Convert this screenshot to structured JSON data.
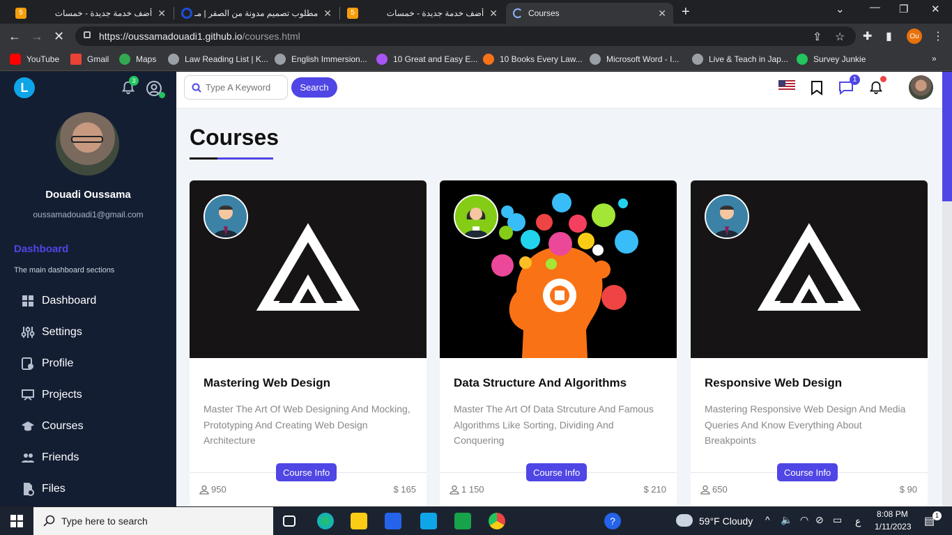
{
  "browser": {
    "tabs": [
      {
        "title": "أضف خدمة جديدة - خمسات",
        "favicon_color": "#f59e0b",
        "favicon_text": "5",
        "active": false
      },
      {
        "title": "مطلوب تصميم مدونة من الصفر | مـ",
        "favicon_color": "#1d4ed8",
        "favicon_text": "",
        "active": false
      },
      {
        "title": "أضف خدمة جديدة - خمسات",
        "favicon_color": "#f59e0b",
        "favicon_text": "5",
        "active": false
      },
      {
        "title": "Courses",
        "favicon_color": "#8ab4f8",
        "favicon_text": "",
        "active": true
      }
    ],
    "url_host": "https://oussamadouadi1.github.io",
    "url_path": "/courses.html",
    "profile_initials": "Ou",
    "bookmarks": [
      {
        "label": "YouTube",
        "color": "#ff0000"
      },
      {
        "label": "Gmail",
        "color": "#ea4335"
      },
      {
        "label": "Maps",
        "color": "#34a853"
      },
      {
        "label": "Law Reading List | K...",
        "color": "#9aa0a6"
      },
      {
        "label": "English Immersion...",
        "color": "#9aa0a6"
      },
      {
        "label": "10 Great and Easy E...",
        "color": "#a855f7"
      },
      {
        "label": "10 Books Every Law...",
        "color": "#f97316"
      },
      {
        "label": "Microsoft Word - I...",
        "color": "#9aa0a6"
      },
      {
        "label": "Live & Teach in Jap...",
        "color": "#9aa0a6"
      },
      {
        "label": "Survey Junkie",
        "color": "#22c55e"
      }
    ]
  },
  "sidebar": {
    "logo_letter": "L",
    "notification_count": "3",
    "user_name": "Douadi Oussama",
    "user_email": "oussamadouadi1@gmail.com",
    "section_title": "Dashboard",
    "section_subtitle": "The main dashboard sections",
    "items": [
      {
        "label": "Dashboard",
        "icon": "grid-icon"
      },
      {
        "label": "Settings",
        "icon": "sliders-icon"
      },
      {
        "label": "Profile",
        "icon": "user-id-icon"
      },
      {
        "label": "Projects",
        "icon": "diagram-icon"
      },
      {
        "label": "Courses",
        "icon": "graduation-cap-icon"
      },
      {
        "label": "Friends",
        "icon": "users-icon"
      },
      {
        "label": "Files",
        "icon": "file-icon"
      }
    ]
  },
  "header": {
    "search_placeholder": "Type A Keyword",
    "search_button": "Search",
    "message_count": "1"
  },
  "main": {
    "page_title": "Courses",
    "courses": [
      {
        "title": "Mastering Web Design",
        "description": "Master The Art Of Web Designing And Mocking, Prototyping And Creating Web Design Architecture",
        "button": "Course Info",
        "students": "950",
        "price": "$ 165",
        "image": "logo"
      },
      {
        "title": "Data Structure And Algorithms",
        "description": "Master The Art Of Data Strcuture And Famous Algorithms Like Sorting, Dividing And Conquering",
        "button": "Course Info",
        "students": "1 150",
        "price": "$ 210",
        "image": "brain"
      },
      {
        "title": "Responsive Web Design",
        "description": "Mastering Responsive Web Design And Media Queries And Know Everything About Breakpoints",
        "button": "Course Info",
        "students": "650",
        "price": "$ 90",
        "image": "logo"
      }
    ]
  },
  "taskbar": {
    "search_placeholder": "Type here to search",
    "weather": "59°F  Cloudy",
    "time": "8:08 PM",
    "date": "1/11/2023",
    "lang": "ع",
    "notifications": "1"
  }
}
